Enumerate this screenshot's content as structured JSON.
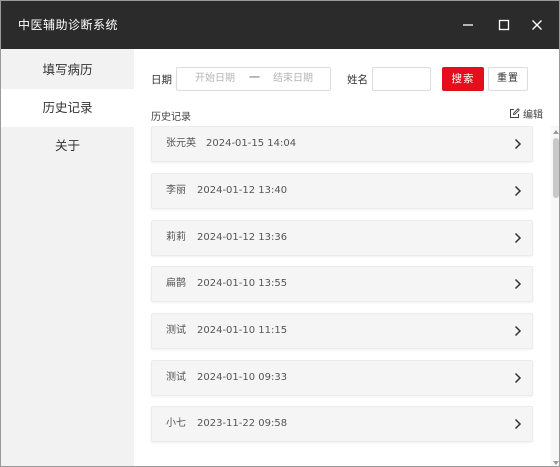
{
  "window": {
    "title": "中医辅助诊断系统"
  },
  "sidebar": {
    "items": [
      {
        "label": "填写病历"
      },
      {
        "label": "历史记录"
      },
      {
        "label": "关于"
      }
    ]
  },
  "filters": {
    "date_label": "日期",
    "date_start_placeholder": "开始日期",
    "date_separator": "一",
    "date_end_placeholder": "结束日期",
    "name_label": "姓名",
    "name_value": "",
    "search_label": "搜索",
    "reset_label": "重置"
  },
  "history": {
    "title": "历史记录",
    "edit_label": "编辑",
    "records": [
      {
        "name": "张元英",
        "time": "2024-01-15 14:04"
      },
      {
        "name": "李丽",
        "time": "2024-01-12 13:40"
      },
      {
        "name": "莉莉",
        "time": "2024-01-12 13:36"
      },
      {
        "name": "扁鹊",
        "time": "2024-01-10 13:55"
      },
      {
        "name": "测试",
        "time": "2024-01-10 11:15"
      },
      {
        "name": "测试",
        "time": "2024-01-10 09:33"
      },
      {
        "name": "小七",
        "time": "2023-11-22 09:58"
      }
    ]
  },
  "colors": {
    "titlebar": "#2b2b2b",
    "accent": "#e3101b",
    "sidebar_bg": "#f2f2f2",
    "record_bg": "#f5f5f5"
  }
}
